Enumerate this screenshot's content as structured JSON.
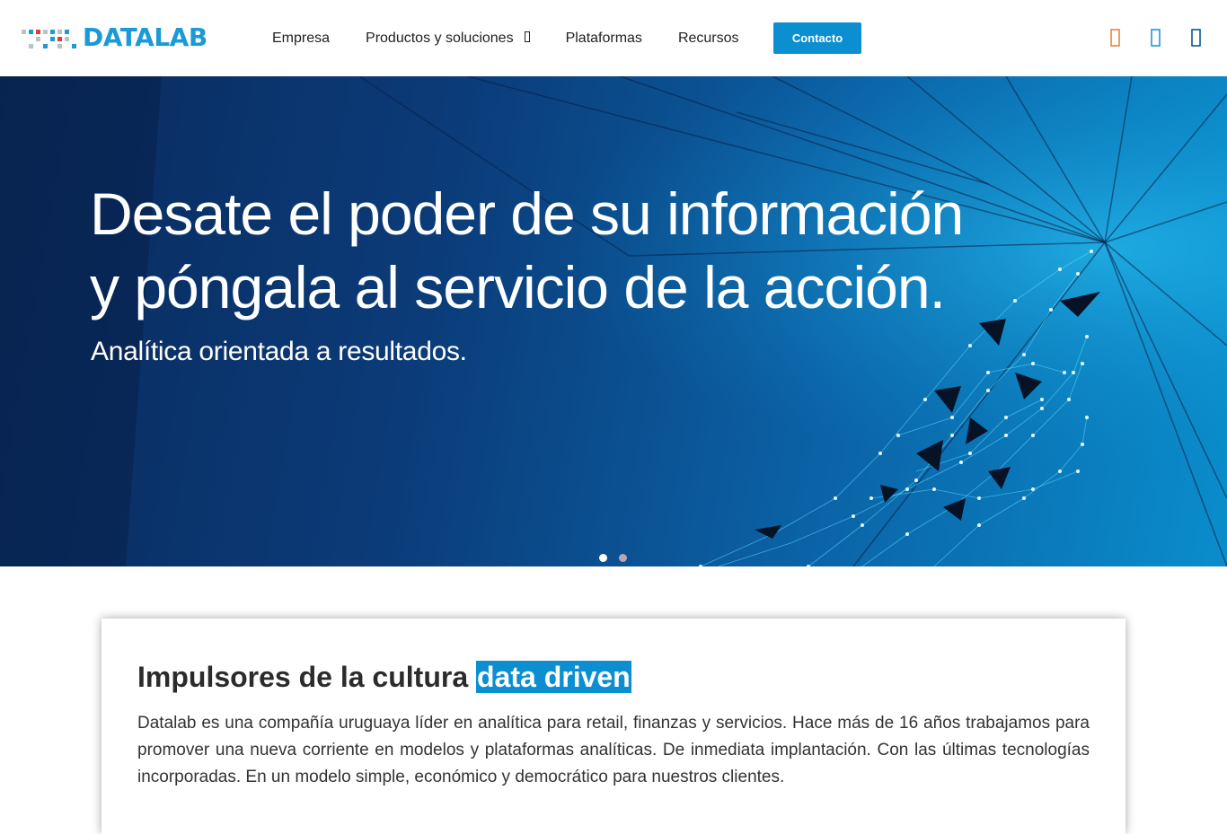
{
  "brand": {
    "name": "DATALAB",
    "color": "#1a9ad6",
    "dot_colors": [
      "#e63b3b",
      "#1a9ad6",
      "#b9c2cc"
    ]
  },
  "nav": {
    "items": [
      {
        "label": "Empresa"
      },
      {
        "label": "Productos y soluciones",
        "has_dropdown": true,
        "dropdown_icon": "chevron-down-icon"
      },
      {
        "label": "Plataformas"
      },
      {
        "label": "Recursos"
      }
    ],
    "contact_label": "Contacto"
  },
  "social": [
    {
      "icon": "facebook-icon",
      "color": "#e8833a"
    },
    {
      "icon": "twitter-icon",
      "color": "#1a9ad6"
    },
    {
      "icon": "linkedin-icon",
      "color": "#0a5a8a"
    }
  ],
  "hero": {
    "title_line1": "Desate el poder de su información",
    "title_line2": "y póngala al servicio de la acción.",
    "subtitle": "Analítica orientada a resultados.",
    "slides_total": 2,
    "active_slide": 1
  },
  "intro": {
    "heading": "Impulsores de la cultura ",
    "heading_highlight": "data driven",
    "body": "Datalab es una compañía uruguaya líder en analítica para retail, finanzas y servicios. Hace más de 16 años trabajamos para promover una nueva corriente en modelos y plataformas analíticas. De inmediata implantación. Con las últimas tecnologías incorporadas. En un modelo simple, económico y democrático para nuestros clientes."
  },
  "colors": {
    "accent": "#0b8fd1",
    "hero_dark": "#0a2a5c",
    "hero_light": "#0a8dcc"
  }
}
